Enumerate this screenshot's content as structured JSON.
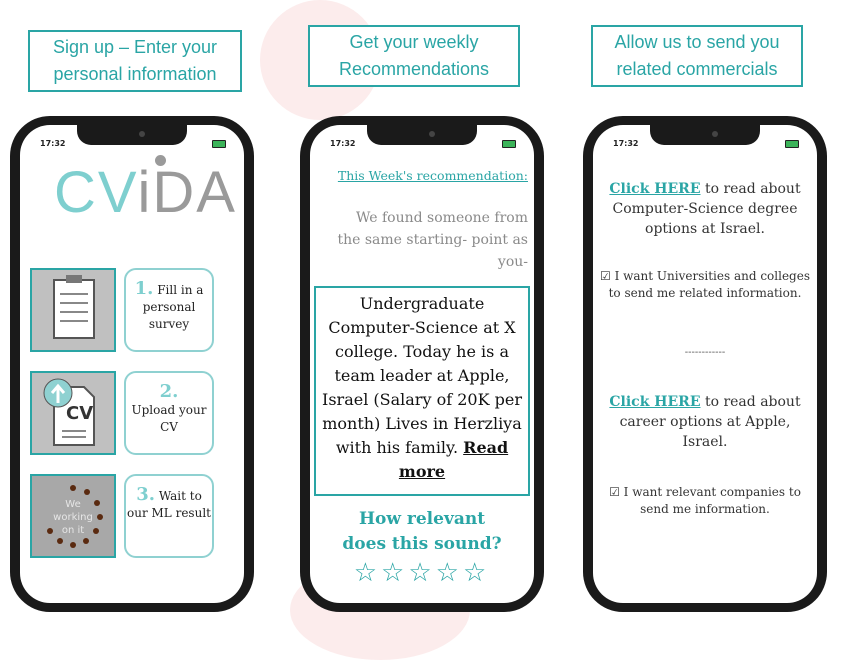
{
  "captions": [
    "Sign up – Enter your personal information",
    "Get your weekly Recommendations",
    "Allow us to send you related commercials"
  ],
  "status_bar": {
    "time": "17:32"
  },
  "phone1": {
    "logo_cv": "CV",
    "logo_ida": "iDA",
    "steps": [
      {
        "num": "1.",
        "text": "Fill in a personal survey"
      },
      {
        "num": "2.",
        "text": "Upload your CV"
      },
      {
        "num": "3.",
        "text": "Wait to our ML result"
      }
    ],
    "cv_label": "CV",
    "working_text": "We working on it"
  },
  "phone2": {
    "heading": "This Week's recommendation:",
    "intro": "We found someone from the same starting- point as you-",
    "recommendation": "Undergraduate Computer-Science at X college. Today he is a team leader at Apple, Israel (Salary of 20K per month) Lives in Herzliya with his family.",
    "read_more": "Read more",
    "question": "How relevant does this sound?",
    "rating": 0,
    "max_rating": 5
  },
  "phone3": {
    "block1_link": "Click HERE",
    "block1_text": "to read about Computer-Science degree options at Israel.",
    "check1": "☑ I want Universities and colleges to send me related information.",
    "separator": "------------",
    "block2_link": "Click HERE",
    "block2_text": "to read about career options at Apple, Israel.",
    "check2": "☑ I want relevant companies to send me information."
  },
  "colors": {
    "accent": "#2aa5a5",
    "logo_teal": "#7ecfcf",
    "logo_grey": "#9a9a9a"
  }
}
